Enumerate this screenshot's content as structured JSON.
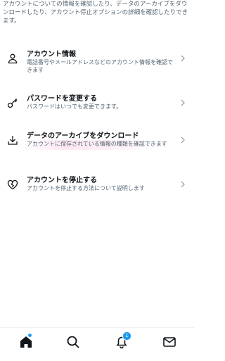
{
  "intro_text": "アカウントについての情報を確認したり、データのアーカイブをダウンロードしたり、アカウント停止オプションの詳細を確認したりできます。",
  "items": [
    {
      "title": "アカウント情報",
      "desc": "電話番号やメールアドレスなどのアカウント情報を確認できます",
      "icon": "person-icon"
    },
    {
      "title": "パスワードを変更する",
      "desc": "パスワードはいつでも変更できます。",
      "icon": "key-icon"
    },
    {
      "title": "データのアーカイブをダウンロード",
      "desc": "アカウントに保存されている情報の種類を確認できます",
      "icon": "download-icon"
    },
    {
      "title": "アカウントを停止する",
      "desc": "アカウントを停止する方法について説明します",
      "icon": "broken-heart-icon"
    }
  ],
  "tabbar": {
    "tabs": [
      "home-icon",
      "search-icon",
      "notifications-icon",
      "messages-icon"
    ],
    "notification_count": "1"
  },
  "colors": {
    "accent": "#1d9bf0",
    "text": "#0f1419",
    "muted": "#536471"
  }
}
